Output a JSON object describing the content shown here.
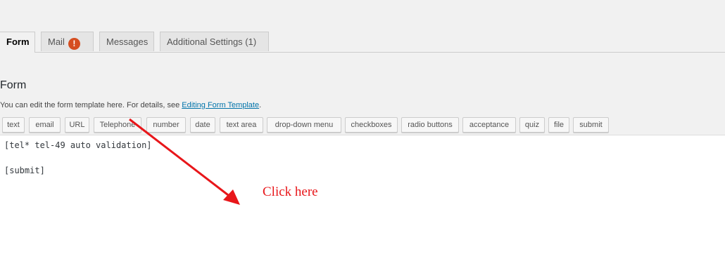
{
  "tabs": [
    {
      "label": "Form",
      "active": true
    },
    {
      "label": "Mail",
      "badge": "!"
    },
    {
      "label": "Messages"
    },
    {
      "label": "Additional Settings (1)"
    }
  ],
  "section": {
    "title": "Form",
    "description_prefix": "You can edit the form template here. For details, see ",
    "description_link": "Editing Form Template",
    "description_suffix": "."
  },
  "tag_buttons": [
    "text",
    "email",
    "URL",
    "Telephone",
    "number",
    "date",
    "text area",
    "drop-down menu",
    "checkboxes",
    "radio buttons",
    "acceptance",
    "quiz",
    "file",
    "submit"
  ],
  "editor": {
    "lines": [
      "[tel* tel-49 auto validation]",
      "",
      "[submit]"
    ]
  },
  "annotation": {
    "text": "Click here",
    "color": "#e8161a"
  },
  "colors": {
    "badge": "#d54e21",
    "link": "#0073aa",
    "background": "#f1f1f1"
  }
}
